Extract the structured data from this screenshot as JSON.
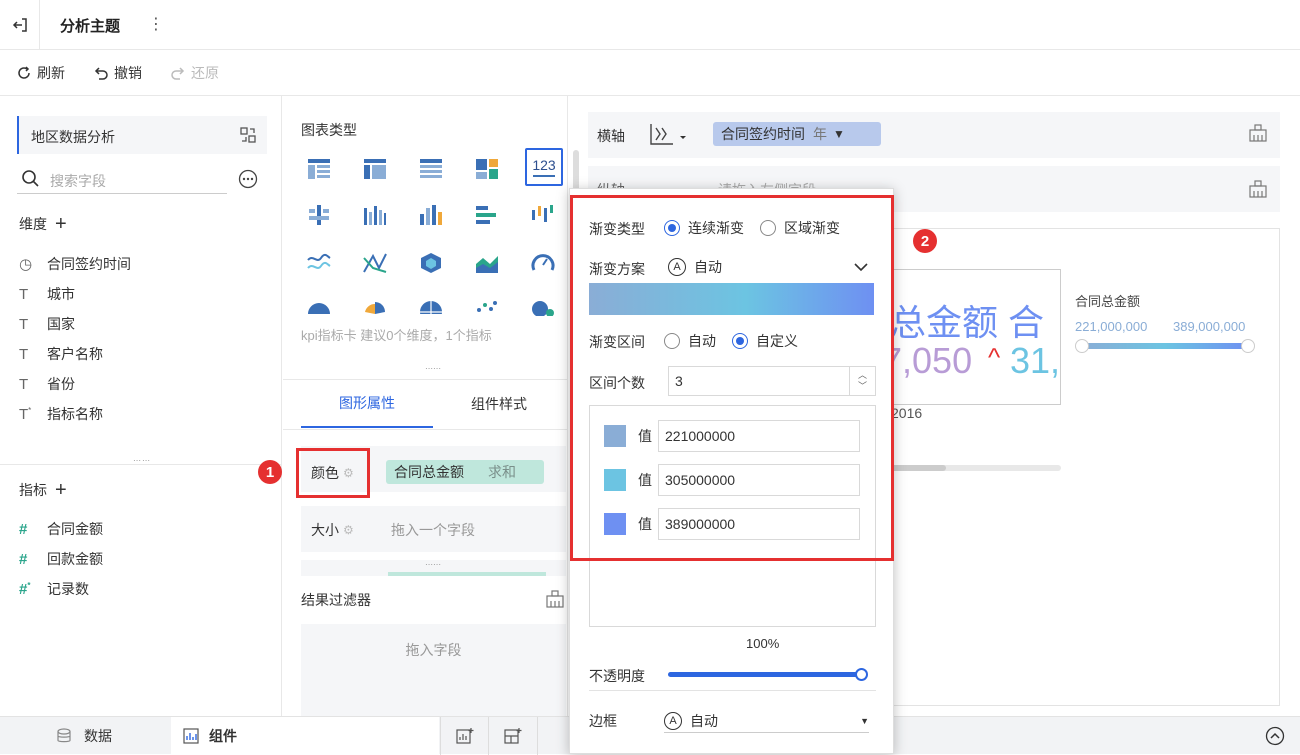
{
  "topbar": {
    "title": "分析主题",
    "more": "⋮",
    "exit_icon": "exit-icon"
  },
  "toolbar": {
    "refresh": "刷新",
    "undo": "撤销",
    "redo": "还原"
  },
  "left": {
    "dataset": "地区数据分析",
    "search_placeholder": "搜索字段",
    "dimension_label": "维度",
    "dimensions": [
      {
        "icon": "clock-icon",
        "name": "合同签约时间"
      },
      {
        "icon": "text-icon",
        "name": "城市"
      },
      {
        "icon": "text-icon",
        "name": "国家"
      },
      {
        "icon": "text-icon",
        "name": "客户名称"
      },
      {
        "icon": "text-icon",
        "name": "省份"
      },
      {
        "icon": "text-star-icon",
        "name": "指标名称"
      }
    ],
    "measure_label": "指标",
    "measures": [
      {
        "icon": "hash-icon",
        "name": "合同金额"
      },
      {
        "icon": "hash-icon",
        "name": "回款金额"
      },
      {
        "icon": "hash-star-icon",
        "name": "记录数"
      }
    ]
  },
  "mid": {
    "chart_type_label": "图表类型",
    "kpi_selected": "123",
    "hint": "kpi指标卡 建议0个维度，1个指标",
    "tabs": [
      "图形属性",
      "组件样式"
    ],
    "color_label": "颜色",
    "color_field": "合同总金额",
    "color_agg": "求和",
    "size_label": "大小",
    "size_placeholder": "拖入一个字段",
    "filter_label": "结果过滤器",
    "filter_placeholder": "拖入字段"
  },
  "right": {
    "xaxis_label": "横轴",
    "xaxis_field": "合同签约时间",
    "xaxis_unit": "年",
    "yaxis_label": "纵轴",
    "yaxis_placeholder": "请拖入左侧字段",
    "kpi_big1": "总金额  合",
    "kpi_big2": "7,050",
    "kpi_big3": "31,",
    "kpi_year": "2016",
    "legend_title": "合同总金额",
    "legend_min": "221,000,000",
    "legend_max": "389,000,000"
  },
  "popup": {
    "gradient_type_label": "渐变类型",
    "gradient_continuous": "连续渐变",
    "gradient_region": "区域渐变",
    "scheme_label": "渐变方案",
    "scheme_value": "自动",
    "range_label": "渐变区间",
    "range_auto": "自动",
    "range_custom": "自定义",
    "count_label": "区间个数",
    "count_value": "3",
    "values": [
      {
        "color": "#8aadd6",
        "label": "值",
        "value": "221000000"
      },
      {
        "color": "#6cc4e2",
        "label": "值",
        "value": "305000000"
      },
      {
        "color": "#6e90f2",
        "label": "值",
        "value": "389000000"
      }
    ],
    "opacity_pct": "100%",
    "opacity_label": "不透明度",
    "border_label": "边框",
    "border_value": "自动"
  },
  "bottombar": {
    "data_tab": "数据",
    "component_tab": "组件"
  },
  "badges": {
    "one": "1",
    "two": "2"
  },
  "colors": {
    "accent": "#2d66e0",
    "red": "#e53030",
    "pill_green": "#bfe7dc",
    "pill_blue": "#b8c9ec"
  }
}
